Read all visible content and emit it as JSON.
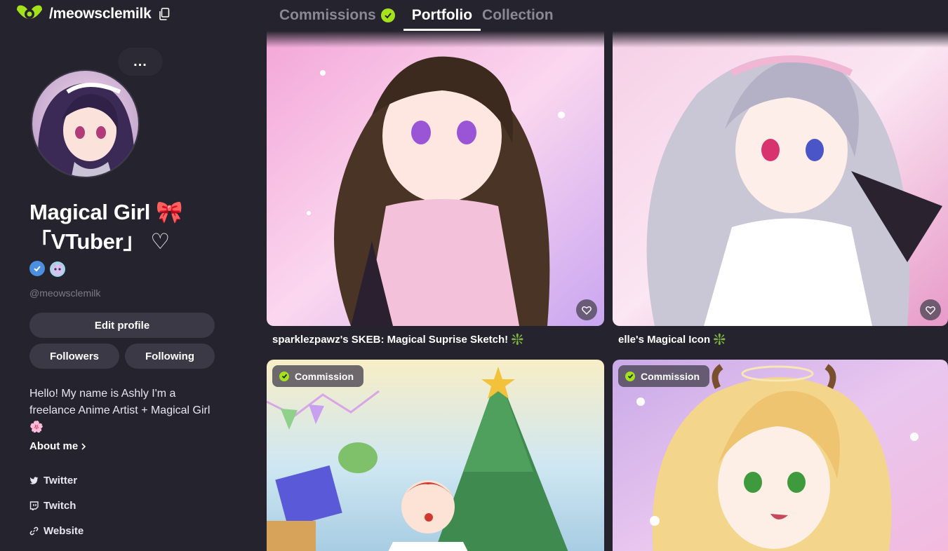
{
  "header": {
    "handle": "/meowsclemilk",
    "tabs": [
      {
        "label": "Commissions",
        "verified": true,
        "active": false
      },
      {
        "label": "Portfolio",
        "active": true
      },
      {
        "label": "Collection",
        "active": false
      }
    ],
    "accent_color": "#a4e21b"
  },
  "profile": {
    "more_label": "...",
    "display_name_line1": "Magical Girl 🎀",
    "display_name_line2": "「VTuber」 ♡",
    "at_handle": "@meowsclemilk",
    "edit_label": "Edit profile",
    "followers_label": "Followers",
    "following_label": "Following",
    "bio": "Hello! My name is Ashly I'm a freelance Anime Artist + Magical Girl 🌸",
    "about_label": "About me",
    "links": [
      {
        "label": "Twitter",
        "icon": "twitter-icon"
      },
      {
        "label": "Twitch",
        "icon": "twitch-icon"
      },
      {
        "label": "Website",
        "icon": "link-icon"
      }
    ]
  },
  "portfolio": {
    "items": [
      {
        "caption": "sparklezpawz's SKEB: Magical Suprise Sketch! ❇️",
        "commission": false
      },
      {
        "caption": "elle's Magical Icon ❇️",
        "commission": false
      },
      {
        "tag": "Commission",
        "commission": true
      },
      {
        "tag": "Commission",
        "commission": true
      }
    ]
  }
}
